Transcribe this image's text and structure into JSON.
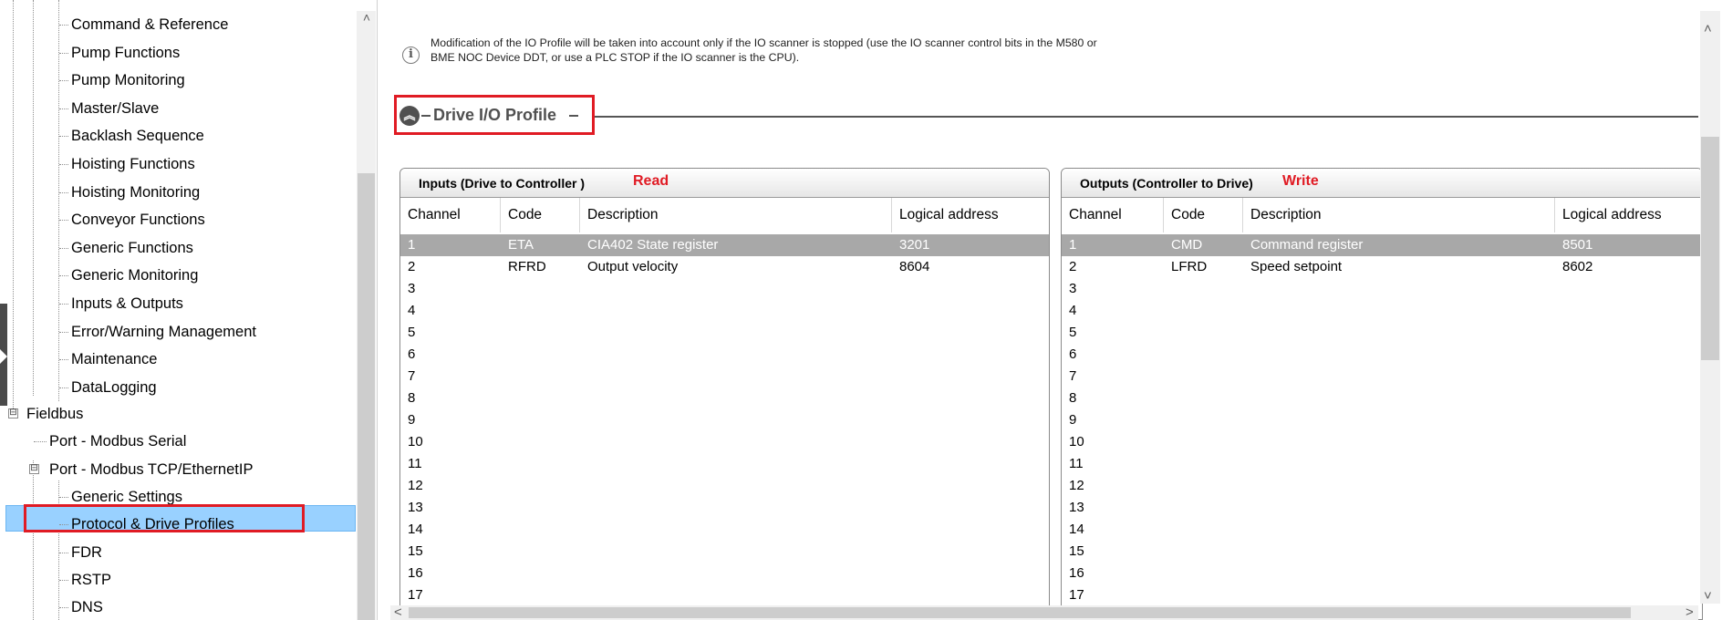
{
  "tree": {
    "items": [
      {
        "label": "Command & Reference"
      },
      {
        "label": "Pump Functions"
      },
      {
        "label": "Pump Monitoring"
      },
      {
        "label": "Master/Slave"
      },
      {
        "label": "Backlash Sequence"
      },
      {
        "label": "Hoisting Functions"
      },
      {
        "label": "Hoisting Monitoring"
      },
      {
        "label": "Conveyor Functions"
      },
      {
        "label": "Generic Functions"
      },
      {
        "label": "Generic Monitoring"
      },
      {
        "label": "Inputs & Outputs"
      },
      {
        "label": "Error/Warning Management"
      },
      {
        "label": "Maintenance"
      },
      {
        "label": "DataLogging"
      }
    ],
    "fieldbus": "Fieldbus",
    "port_serial": "Port - Modbus Serial",
    "port_tcp": "Port - Modbus TCP/EthernetIP",
    "sub_items": [
      {
        "label": "Generic Settings"
      },
      {
        "label": "Protocol & Drive Profiles"
      },
      {
        "label": "FDR"
      },
      {
        "label": "RSTP"
      },
      {
        "label": "DNS"
      }
    ],
    "selected": "Protocol & Drive Profiles",
    "expander_minus": "⊟"
  },
  "info": {
    "icon": "info-icon",
    "text": "Modification of the IO Profile will be taken into account only if the IO scanner is stopped (use the IO scanner control bits in the M580 or BME NOC Device DDT, or use a PLC STOP if the IO scanner is the CPU)."
  },
  "section": {
    "title": "Drive I/O Profile",
    "collapse_icon": "double-chevron-up-icon"
  },
  "inputs_table": {
    "title": "Inputs (Drive to Controller )",
    "tag": "Read",
    "columns": [
      "Channel",
      "Code",
      "Description",
      "Logical address"
    ],
    "rows": [
      {
        "channel": "1",
        "code": "ETA",
        "description": "CIA402 State register",
        "address": "3201"
      },
      {
        "channel": "2",
        "code": "RFRD",
        "description": "Output velocity",
        "address": "8604"
      },
      {
        "channel": "3",
        "code": "",
        "description": "",
        "address": ""
      },
      {
        "channel": "4",
        "code": "",
        "description": "",
        "address": ""
      },
      {
        "channel": "5",
        "code": "",
        "description": "",
        "address": ""
      },
      {
        "channel": "6",
        "code": "",
        "description": "",
        "address": ""
      },
      {
        "channel": "7",
        "code": "",
        "description": "",
        "address": ""
      },
      {
        "channel": "8",
        "code": "",
        "description": "",
        "address": ""
      },
      {
        "channel": "9",
        "code": "",
        "description": "",
        "address": ""
      },
      {
        "channel": "10",
        "code": "",
        "description": "",
        "address": ""
      },
      {
        "channel": "11",
        "code": "",
        "description": "",
        "address": ""
      },
      {
        "channel": "12",
        "code": "",
        "description": "",
        "address": ""
      },
      {
        "channel": "13",
        "code": "",
        "description": "",
        "address": ""
      },
      {
        "channel": "14",
        "code": "",
        "description": "",
        "address": ""
      },
      {
        "channel": "15",
        "code": "",
        "description": "",
        "address": ""
      },
      {
        "channel": "16",
        "code": "",
        "description": "",
        "address": ""
      },
      {
        "channel": "17",
        "code": "",
        "description": "",
        "address": ""
      }
    ]
  },
  "outputs_table": {
    "title": "Outputs (Controller to Drive)",
    "tag": "Write",
    "columns": [
      "Channel",
      "Code",
      "Description",
      "Logical address"
    ],
    "rows": [
      {
        "channel": "1",
        "code": "CMD",
        "description": "Command register",
        "address": "8501"
      },
      {
        "channel": "2",
        "code": "LFRD",
        "description": "Speed setpoint",
        "address": "8602"
      },
      {
        "channel": "3",
        "code": "",
        "description": "",
        "address": ""
      },
      {
        "channel": "4",
        "code": "",
        "description": "",
        "address": ""
      },
      {
        "channel": "5",
        "code": "",
        "description": "",
        "address": ""
      },
      {
        "channel": "6",
        "code": "",
        "description": "",
        "address": ""
      },
      {
        "channel": "7",
        "code": "",
        "description": "",
        "address": ""
      },
      {
        "channel": "8",
        "code": "",
        "description": "",
        "address": ""
      },
      {
        "channel": "9",
        "code": "",
        "description": "",
        "address": ""
      },
      {
        "channel": "10",
        "code": "",
        "description": "",
        "address": ""
      },
      {
        "channel": "11",
        "code": "",
        "description": "",
        "address": ""
      },
      {
        "channel": "12",
        "code": "",
        "description": "",
        "address": ""
      },
      {
        "channel": "13",
        "code": "",
        "description": "",
        "address": ""
      },
      {
        "channel": "14",
        "code": "",
        "description": "",
        "address": ""
      },
      {
        "channel": "15",
        "code": "",
        "description": "",
        "address": ""
      },
      {
        "channel": "16",
        "code": "",
        "description": "",
        "address": ""
      },
      {
        "channel": "17",
        "code": "",
        "description": "",
        "address": ""
      }
    ]
  },
  "scroll": {
    "up": "˄",
    "down": "˅",
    "left": "˂",
    "right": "˃"
  },
  "colors": {
    "highlight_box": "#e01b24",
    "selection": "#99d1ff",
    "row_selected": "#a8a8a8"
  }
}
